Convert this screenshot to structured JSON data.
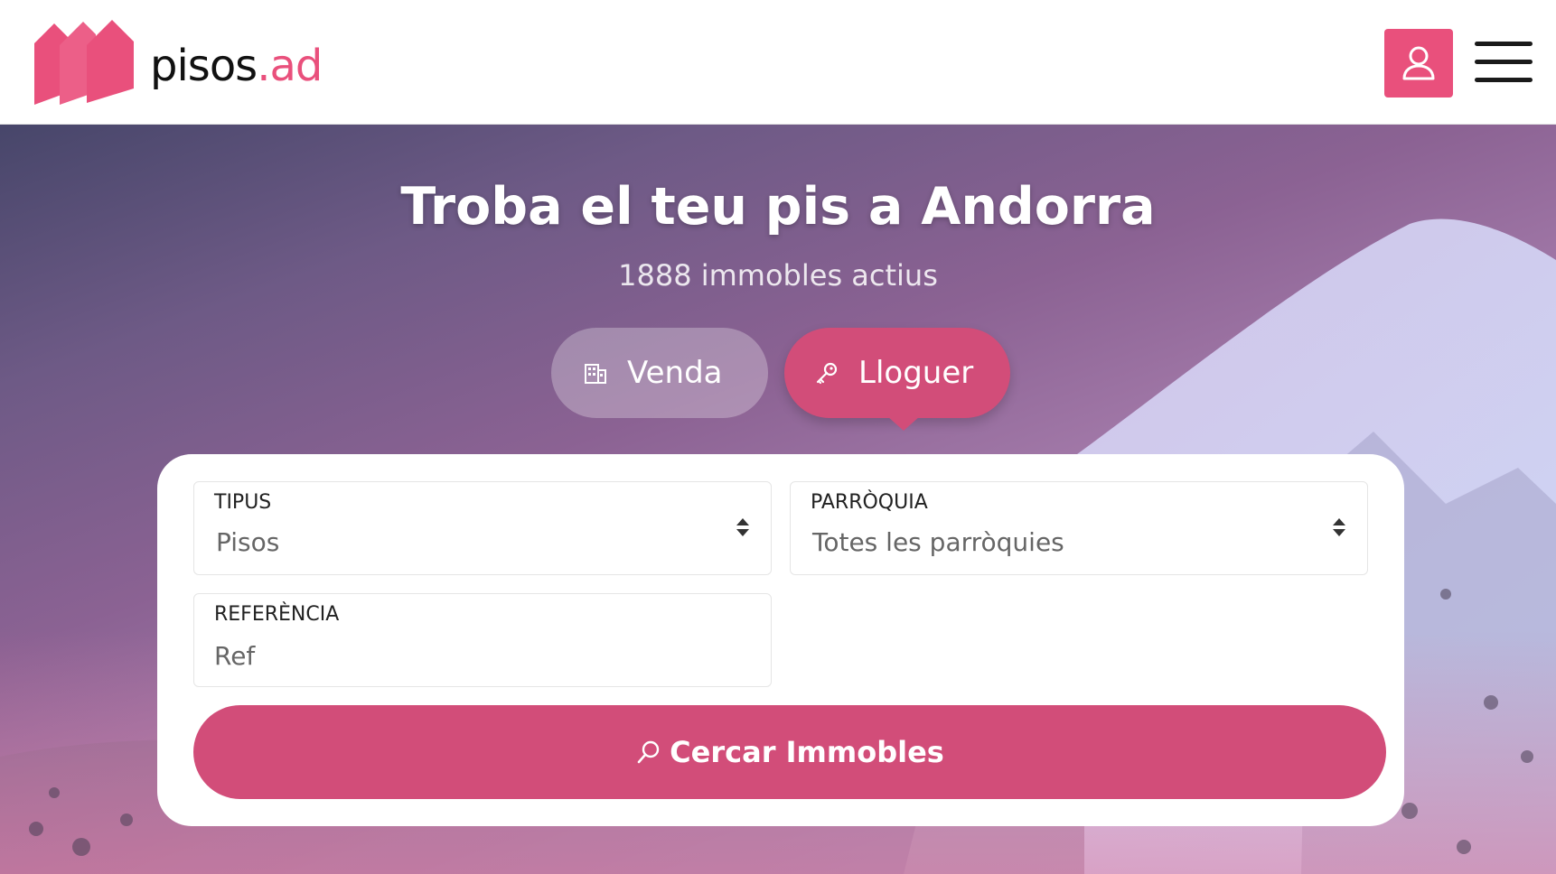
{
  "header": {
    "logo_brand": "pisos",
    "logo_tld": ".ad",
    "user_icon": "user-icon",
    "menu_icon": "hamburger-menu-icon"
  },
  "hero": {
    "title": "Troba el teu pis a Andorra",
    "subtitle": "1888 immobles actius",
    "tabs": [
      {
        "label": "Venda",
        "icon": "building-icon",
        "active": false
      },
      {
        "label": "Lloguer",
        "icon": "key-icon",
        "active": true
      }
    ]
  },
  "search": {
    "tipus": {
      "label": "TIPUS",
      "value": "Pisos"
    },
    "parroquia": {
      "label": "PARRÒQUIA",
      "value": "Totes les parròquies"
    },
    "referencia": {
      "label": "REFERÈNCIA",
      "placeholder": "Ref"
    },
    "submit_label": "Cercar Immobles",
    "submit_icon": "search-icon"
  },
  "colors": {
    "accent": "#e9507c",
    "button": "#d24d79"
  }
}
